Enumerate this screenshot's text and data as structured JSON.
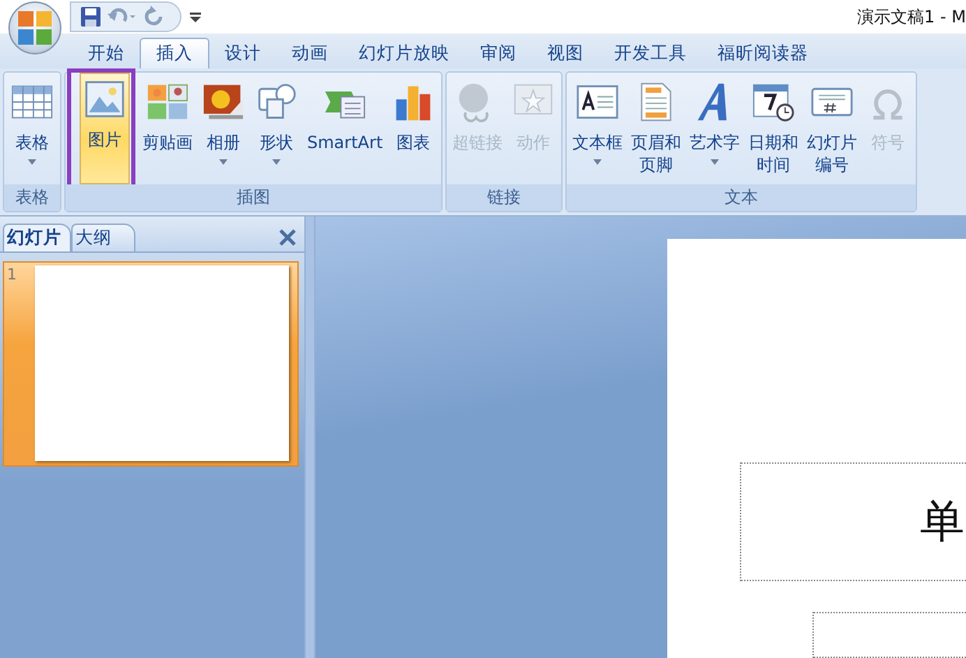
{
  "window": {
    "title": "演示文稿1 - M"
  },
  "tabs": [
    {
      "label": "开始",
      "selected": false
    },
    {
      "label": "插入",
      "selected": true
    },
    {
      "label": "设计",
      "selected": false
    },
    {
      "label": "动画",
      "selected": false
    },
    {
      "label": "幻灯片放映",
      "selected": false
    },
    {
      "label": "审阅",
      "selected": false
    },
    {
      "label": "视图",
      "selected": false
    },
    {
      "label": "开发工具",
      "selected": false
    },
    {
      "label": "福昕阅读器",
      "selected": false
    }
  ],
  "groups": [
    {
      "label": "表格",
      "buttons": [
        {
          "kind": "table",
          "lines": [
            "表格"
          ],
          "dropdown": true,
          "disabled": false,
          "selected": false,
          "outlined": false
        }
      ]
    },
    {
      "label": "插图",
      "buttons": [
        {
          "kind": "picture",
          "lines": [
            "图片"
          ],
          "dropdown": false,
          "disabled": false,
          "selected": true,
          "outlined": true
        },
        {
          "kind": "clipart",
          "lines": [
            "剪贴画"
          ],
          "dropdown": false,
          "disabled": false,
          "selected": false,
          "outlined": false
        },
        {
          "kind": "album",
          "lines": [
            "相册"
          ],
          "dropdown": true,
          "disabled": false,
          "selected": false,
          "outlined": false
        },
        {
          "kind": "shapes",
          "lines": [
            "形状"
          ],
          "dropdown": true,
          "disabled": false,
          "selected": false,
          "outlined": false
        },
        {
          "kind": "smartart",
          "lines": [
            "SmartArt"
          ],
          "dropdown": false,
          "disabled": false,
          "selected": false,
          "outlined": false
        },
        {
          "kind": "chart",
          "lines": [
            "图表"
          ],
          "dropdown": false,
          "disabled": false,
          "selected": false,
          "outlined": false
        }
      ]
    },
    {
      "label": "链接",
      "buttons": [
        {
          "kind": "hyperlink",
          "lines": [
            "超链接"
          ],
          "dropdown": false,
          "disabled": true,
          "selected": false,
          "outlined": false
        },
        {
          "kind": "action",
          "lines": [
            "动作"
          ],
          "dropdown": false,
          "disabled": true,
          "selected": false,
          "outlined": false
        }
      ]
    },
    {
      "label": "文本",
      "buttons": [
        {
          "kind": "textbox",
          "lines": [
            "文本框"
          ],
          "dropdown": true,
          "disabled": false,
          "selected": false,
          "outlined": false
        },
        {
          "kind": "header",
          "lines": [
            "页眉和",
            "页脚"
          ],
          "dropdown": false,
          "disabled": false,
          "selected": false,
          "outlined": false
        },
        {
          "kind": "wordart",
          "lines": [
            "艺术字"
          ],
          "dropdown": true,
          "disabled": false,
          "selected": false,
          "outlined": false
        },
        {
          "kind": "datetime",
          "lines": [
            "日期和",
            "时间"
          ],
          "dropdown": false,
          "disabled": false,
          "selected": false,
          "outlined": false
        },
        {
          "kind": "slidenumber",
          "lines": [
            "幻灯片",
            "编号"
          ],
          "dropdown": false,
          "disabled": false,
          "selected": false,
          "outlined": false
        },
        {
          "kind": "symbol",
          "lines": [
            "符号"
          ],
          "dropdown": false,
          "disabled": true,
          "selected": false,
          "outlined": false
        }
      ]
    }
  ],
  "pane": {
    "tabs": [
      {
        "label": "幻灯片",
        "selected": true
      },
      {
        "label": "大纲",
        "selected": false
      }
    ],
    "slides": [
      {
        "number": "1",
        "selected": true
      }
    ]
  },
  "slide": {
    "title_text": "单"
  }
}
